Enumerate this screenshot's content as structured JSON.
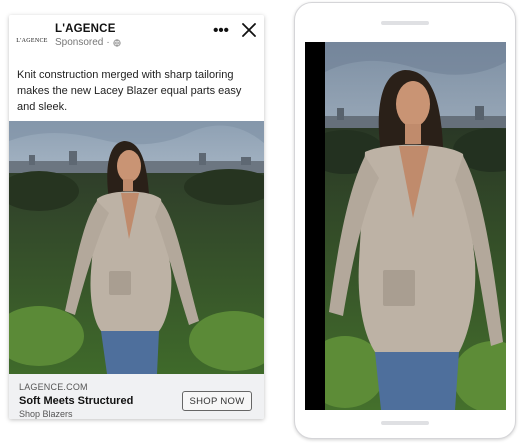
{
  "ad": {
    "brand_name": "L'AGENCE",
    "logo_text": "L'AGENCE",
    "sponsored_label": "Sponsored",
    "more_icon": "more-horizontal-icon",
    "close_icon": "close-icon",
    "body_text": "Knit construction merged with sharp tailoring makes the new Lacey Blazer equal parts easy and sleek.",
    "photo_subject": "",
    "cta": {
      "domain": "LAGENCE.COM",
      "headline": "Soft Meets Structured",
      "subtext": "Shop Blazers",
      "button_label": "SHOP NOW"
    }
  },
  "phone_preview": {
    "photo_subject": ""
  },
  "colors": {
    "cta_bar_bg": "#f0f1f3",
    "blazer": "#bdb2a5",
    "jeans": "#4e6f9c",
    "sky": "#aebfcf",
    "foliage": "#3e5a2c"
  }
}
